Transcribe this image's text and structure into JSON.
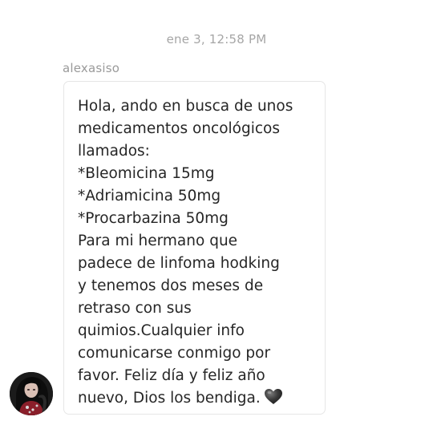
{
  "conversation": {
    "timestamp": "ene 3, 12:58 PM",
    "sender": {
      "username": "alexasiso",
      "avatar_icon": "profile-photo-icon"
    },
    "message": {
      "lines": [
        "Hola, ando en busca de unos",
        "medicamentos oncológicos",
        "llamados:",
        "*Bleomicina 15mg",
        "*Adriamicina 50mg",
        "*Procarbazina 50mg",
        "Para mi hermano que",
        "padece de linfoma  hodking",
        "y tenemos dos meses de",
        "retraso con sus",
        "quimios.Cualquier info",
        "comunicarse conmigo por",
        "favor. Feliz día y feliz año",
        "nuevo, Dios los bendiga."
      ],
      "emoji_icon": "black-heart-icon"
    }
  }
}
